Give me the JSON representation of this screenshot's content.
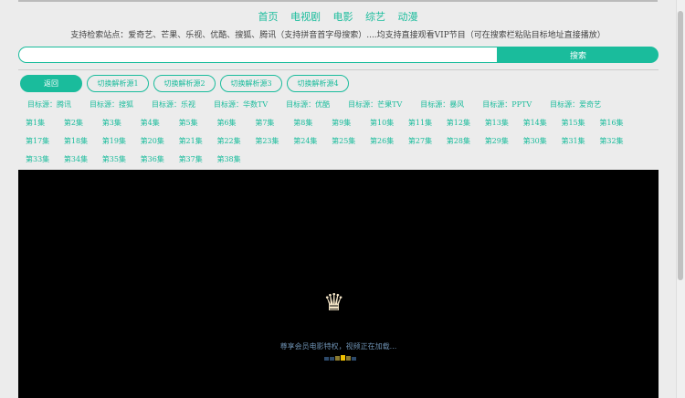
{
  "nav": [
    "首页",
    "电视剧",
    "电影",
    "综艺",
    "动漫"
  ],
  "notice": "支持检索站点：爱奇艺、芒果、乐视、优酷、搜狐、腾讯（支持拼音首字母搜索）....均支持直接观看VIP节目（可在搜索栏粘贴目标地址直接播放）",
  "search": {
    "placeholder": "",
    "button": "搜索"
  },
  "buttons": [
    "返回",
    "切换解析源1",
    "切换解析源2",
    "切换解析源3",
    "切换解析源4"
  ],
  "sources": [
    "目标源：腾讯",
    "目标源：搜狐",
    "目标源：乐视",
    "目标源：华数TV",
    "目标源：优酷",
    "目标源：芒果TV",
    "目标源：暴风",
    "目标源：PPTV",
    "目标源：爱奇艺"
  ],
  "episodes": [
    "第1集",
    "第2集",
    "第3集",
    "第4集",
    "第5集",
    "第6集",
    "第7集",
    "第8集",
    "第9集",
    "第10集",
    "第11集",
    "第12集",
    "第13集",
    "第14集",
    "第15集",
    "第16集",
    "第17集",
    "第18集",
    "第19集",
    "第20集",
    "第21集",
    "第22集",
    "第23集",
    "第24集",
    "第25集",
    "第26集",
    "第27集",
    "第28集",
    "第29集",
    "第30集",
    "第31集",
    "第32集",
    "第33集",
    "第34集",
    "第35集",
    "第36集",
    "第37集",
    "第38集"
  ],
  "player": {
    "message": "尊享会员电影特权，视频正在加载..."
  },
  "colors": {
    "accent": "#1abc9c"
  }
}
